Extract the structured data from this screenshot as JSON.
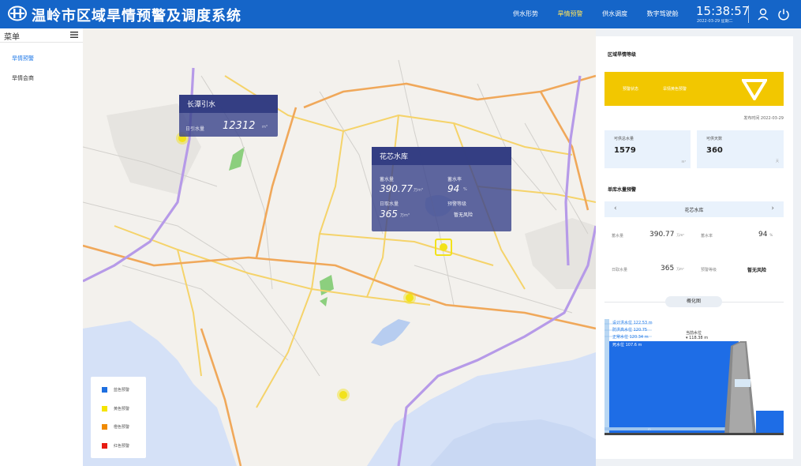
{
  "header": {
    "title": "温岭市区域旱情预警及调度系统",
    "nav": [
      {
        "label": "供水形势",
        "active": false
      },
      {
        "label": "旱情预警",
        "active": true
      },
      {
        "label": "供水调度",
        "active": false
      },
      {
        "label": "数字驾驶舱",
        "active": false
      }
    ],
    "time": "15:38:57",
    "date": "2022-03-29 星期二",
    "icons": [
      "user-icon",
      "power-icon"
    ]
  },
  "sidebar": {
    "title": "菜单",
    "items": [
      {
        "label": "旱情预警",
        "active": true
      },
      {
        "label": "旱情会商",
        "active": false
      }
    ]
  },
  "map": {
    "popup_changtan": {
      "name": "长潭引水",
      "label": "日引水量",
      "value": "12312",
      "unit": "m³"
    },
    "popup_huaxin": {
      "name": "花芯水库",
      "storage_label": "蓄水量",
      "storage_value": "390.77",
      "storage_unit": "万m³",
      "rate_label": "蓄水率",
      "rate_value": "94",
      "rate_unit": "%",
      "intake_label": "日取水量",
      "intake_value": "365",
      "intake_unit": "万m³",
      "level_label": "预警等级",
      "level_value": "暂无风险"
    },
    "legend": [
      {
        "label": "蓝色预警",
        "color": "#1e6fe0"
      },
      {
        "label": "黄色预警",
        "color": "#f5e400"
      },
      {
        "label": "橙色预警",
        "color": "#f08a00"
      },
      {
        "label": "红色预警",
        "color": "#e61b12"
      }
    ],
    "colors": {
      "sea": "#d5e1f7",
      "road_yellow": "#f5d36a",
      "road_orange": "#f0a85a",
      "highway": "#b69ae8",
      "marker": "#f2e21a"
    }
  },
  "panel": {
    "region_title": "区域旱情等级",
    "status_label": "预警状态",
    "status_value": "旱情黄色预警",
    "publish_time": "发布时间 2022-03-29",
    "supply_label": "可供总水量",
    "supply_value": "1579",
    "supply_unit": "m³",
    "days_label": "可供天数",
    "days_value": "360",
    "days_unit": "天",
    "reservoir_title": "单库水量预警",
    "selected": "花芯水库",
    "storage_label": "蓄水量",
    "storage_value": "390.77",
    "storage_unit": "万m³",
    "rate_label": "蓄水率",
    "rate_value": "94",
    "rate_unit": "%",
    "intake_label": "日取水量",
    "intake_value": "365",
    "intake_unit": "万m³",
    "level_label": "预警等级",
    "level_value": "暂无风险",
    "overview_title": "概化图",
    "overview": {
      "design_label": "设计洪水位",
      "design_value": "122.53",
      "m1": "m",
      "flood_label": "防洪高水位",
      "flood_value": "120.75",
      "normal_label": "正常水位",
      "normal_value": "120.34",
      "m3": "m",
      "dead_label": "死水位",
      "dead_value": "107.6",
      "m4": "m",
      "current_label": "当前水位",
      "current_value": "▾ 118.38",
      "m5": "m",
      "bottom": "m"
    }
  }
}
